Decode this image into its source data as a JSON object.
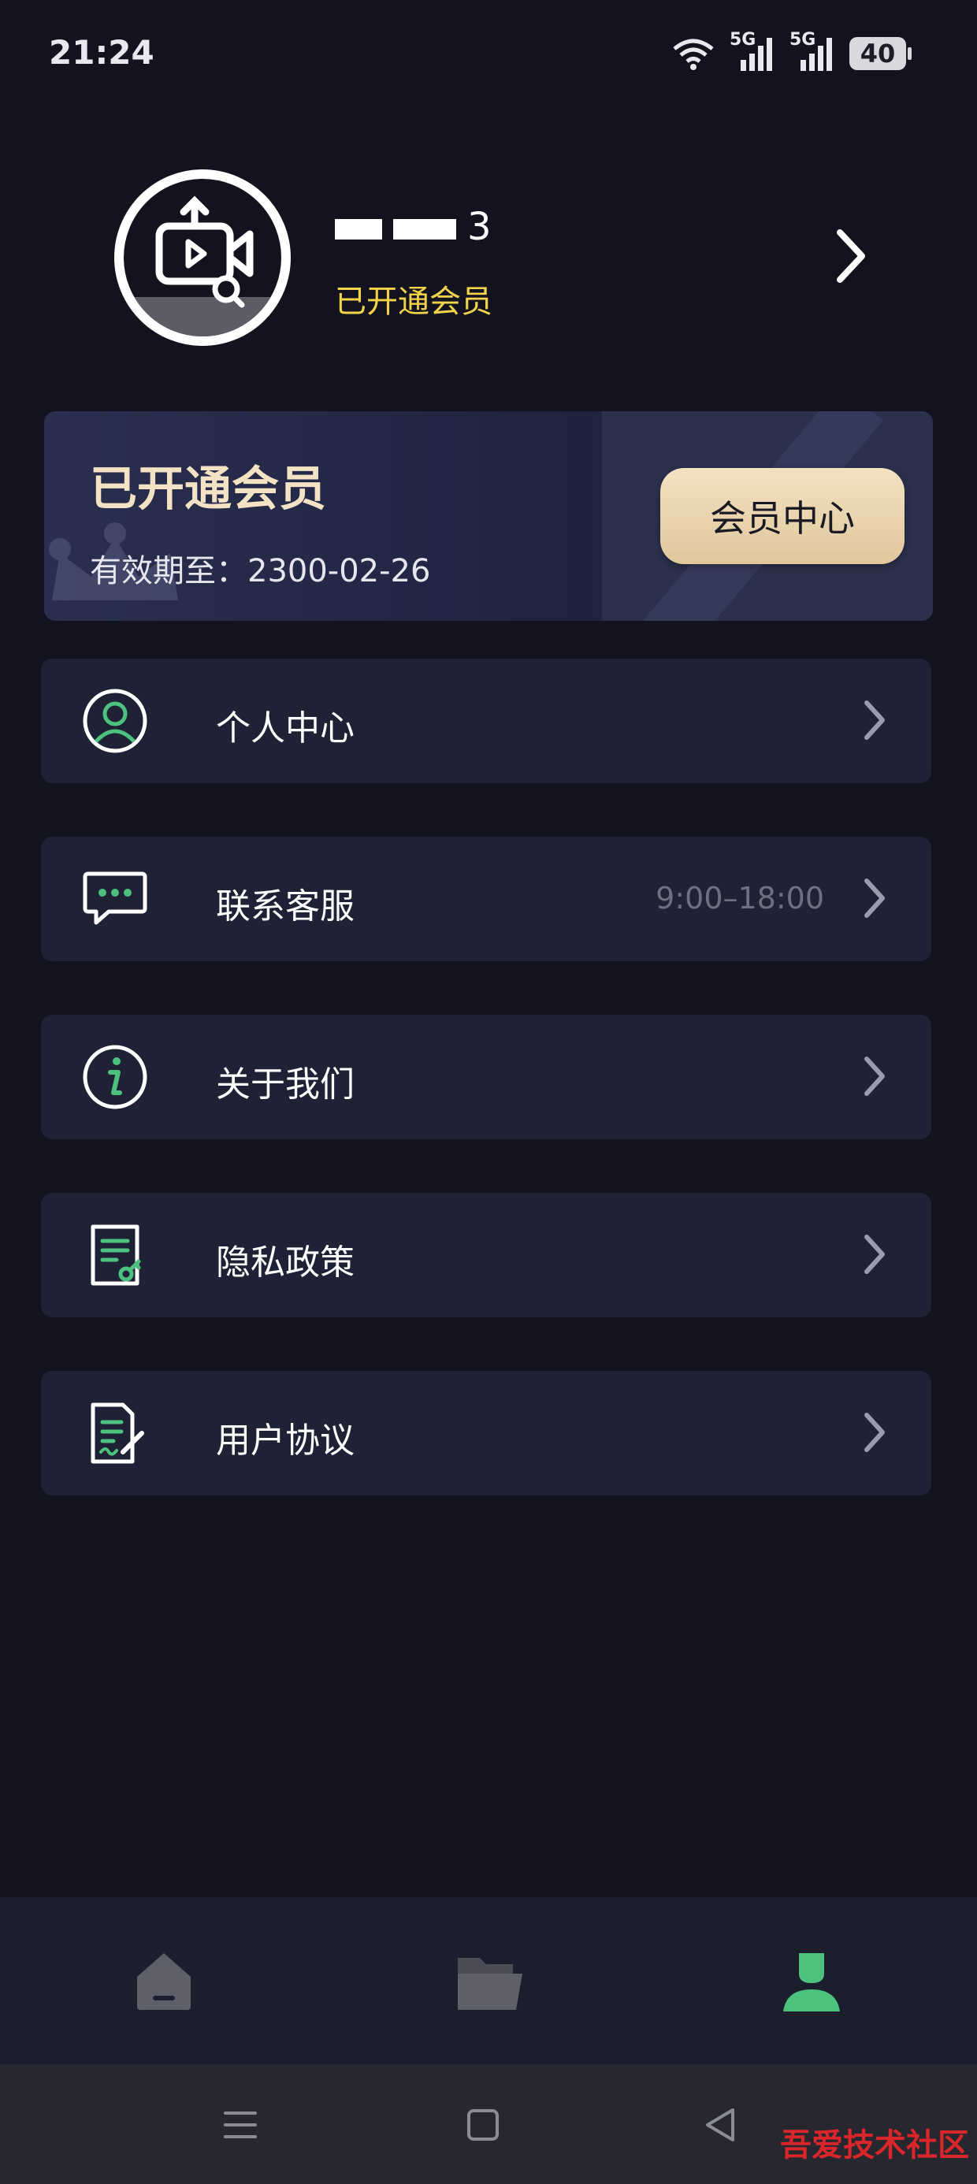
{
  "status_bar": {
    "time": "21:24",
    "network_1": "5G",
    "network_2": "5G",
    "battery": "40"
  },
  "profile": {
    "name_suffix": "3",
    "status": "已开通会员"
  },
  "vip_card": {
    "title": "已开通会员",
    "expiry": "有效期至：2300-02-26",
    "button_label": "会员中心"
  },
  "menu": {
    "items": [
      {
        "label": "个人中心",
        "extra": ""
      },
      {
        "label": "联系客服",
        "extra": "9:00–18:00"
      },
      {
        "label": "关于我们",
        "extra": ""
      },
      {
        "label": "隐私政策",
        "extra": ""
      },
      {
        "label": "用户协议",
        "extra": ""
      }
    ]
  },
  "bottom_nav": {
    "tabs": [
      {
        "icon": "home-icon",
        "active": false
      },
      {
        "icon": "folder-icon",
        "active": false
      },
      {
        "icon": "user-icon",
        "active": true
      }
    ]
  },
  "watermark": "吾爱技术社区",
  "colors": {
    "background": "#12131f",
    "card": "#1f2134",
    "accent_green": "#4dc27f",
    "vip_gold": "#f3e3c4",
    "member_yellow": "#f2d34a"
  }
}
